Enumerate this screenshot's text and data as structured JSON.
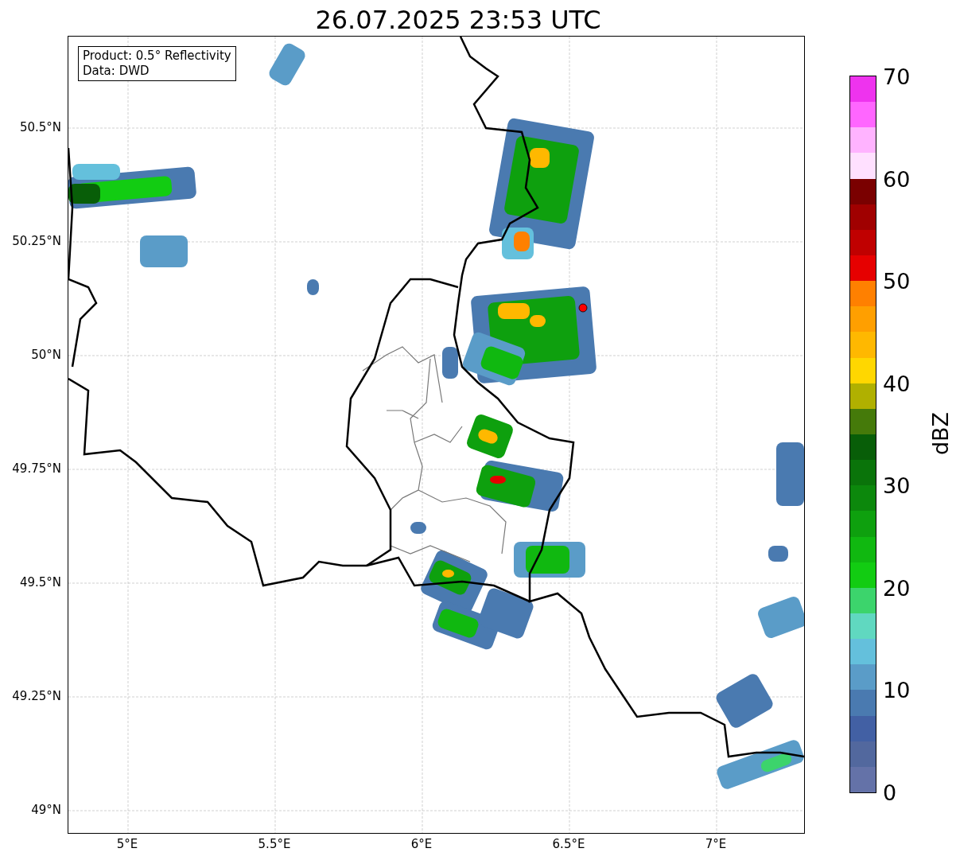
{
  "title": "26.07.2025 23:53 UTC",
  "map": {
    "info_box": [
      "Product: 0.5° Reflectivity",
      "Data: DWD"
    ],
    "x_ticks": [
      "5°E",
      "5.5°E",
      "6°E",
      "6.5°E",
      "7°E"
    ],
    "y_ticks": [
      "50.5°N",
      "50.25°N",
      "50°N",
      "49.75°N",
      "49.5°N",
      "49.25°N",
      "49°N"
    ]
  },
  "colorbar": {
    "label": "dBZ",
    "ticks": [
      "70",
      "60",
      "50",
      "40",
      "30",
      "20",
      "10",
      "0"
    ],
    "bins": [
      {
        "color": "#ee33ee"
      },
      {
        "color": "#ff66ff"
      },
      {
        "color": "#ffb3ff"
      },
      {
        "color": "#ffe0ff"
      },
      {
        "color": "#7a0000"
      },
      {
        "color": "#a00000"
      },
      {
        "color": "#c00000"
      },
      {
        "color": "#e60000"
      },
      {
        "color": "#ff8000"
      },
      {
        "color": "#ff9f00"
      },
      {
        "color": "#ffb800"
      },
      {
        "color": "#ffd700"
      },
      {
        "color": "#b0b000"
      },
      {
        "color": "#457a0a"
      },
      {
        "color": "#085e08"
      },
      {
        "color": "#0a740a"
      },
      {
        "color": "#0c880c"
      },
      {
        "color": "#0ea00e"
      },
      {
        "color": "#10b810"
      },
      {
        "color": "#12cc12"
      },
      {
        "color": "#3cd46c"
      },
      {
        "color": "#60d8c0"
      },
      {
        "color": "#64c0dc"
      },
      {
        "color": "#5a9cc8"
      },
      {
        "color": "#4a7ab0"
      },
      {
        "color": "#4260a4"
      },
      {
        "color": "#52689e"
      },
      {
        "color": "#6472a8"
      }
    ]
  }
}
